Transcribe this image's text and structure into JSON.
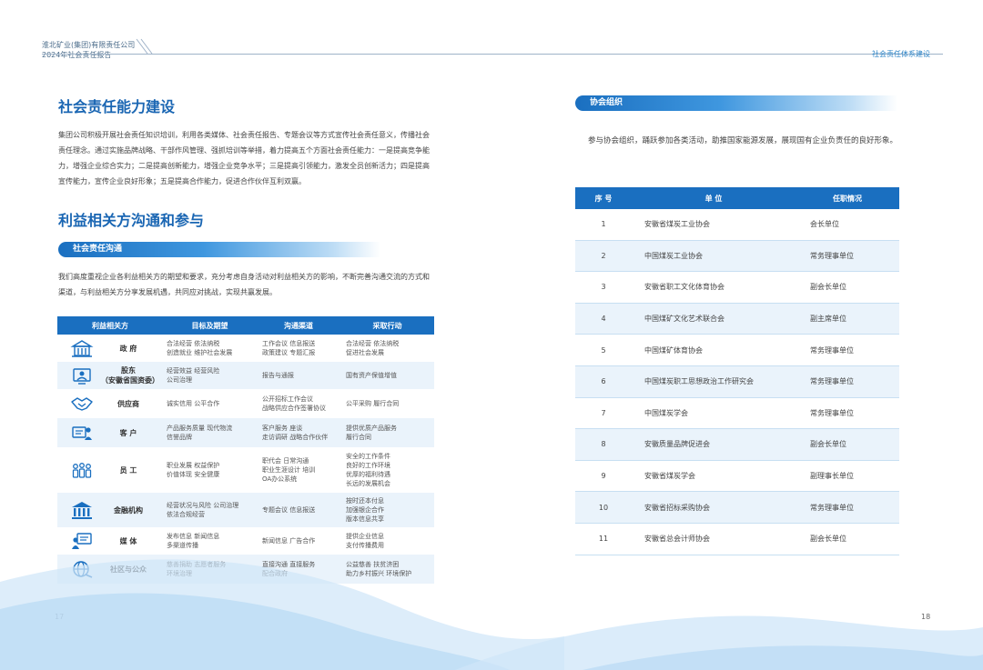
{
  "header": {
    "company": "淮北矿业(集团)有限责任公司",
    "report": "2024年社会责任报告",
    "section": "社会责任体系建设"
  },
  "left": {
    "capacity": {
      "title": "社会责任能力建设",
      "text": "集团公司积极开展社会责任知识培训，利用各类媒体、社会责任报告、专题会议等方式宣传社会责任意义，传播社会责任理念。通过实施品牌战略、干部作风管理、强抓培训等举措，着力提高五个方面社会责任能力：一是提高竞争能力，增强企业综合实力；二是提高创新能力，增强企业竞争水平；三是提高引领能力，激发全员创新活力；四是提高宣传能力，宣传企业良好形象；五是提高合作能力，促进合作伙伴互利双赢。"
    },
    "stakeholder": {
      "title": "利益相关方沟通和参与",
      "subtitle": "社会责任沟通",
      "text": "我们高度重视企业各利益相关方的期望和要求，充分考虑自身活动对利益相关方的影响，不断完善沟通交流的方式和渠道，与利益相关方分享发展机遇，共同应对挑战，实现共赢发展。",
      "columns": [
        "利益相关方",
        "目标及期望",
        "沟通渠道",
        "采取行动"
      ],
      "rows": [
        {
          "icon": "government-icon",
          "name": "政 府",
          "goals": "合法经营 依法纳税\n创造就业 维护社会发展",
          "channels": "工作会议 信息报送\n政策建议 专题汇报",
          "actions": "合法经营 依法纳税\n促进社会发展"
        },
        {
          "icon": "shareholder-icon",
          "name": "股东\n（安徽省国资委）",
          "goals": "经营效益 经营风险\n公司治理",
          "channels": "报告与通报",
          "actions": "国有资产保值增值"
        },
        {
          "icon": "handshake-icon",
          "name": "供应商",
          "goals": "诚实信用 公平合作",
          "channels": "公开招标工作会议\n战略供应合作签署协议",
          "actions": "公平采购 履行合同"
        },
        {
          "icon": "customer-icon",
          "name": "客 户",
          "goals": "产品服务质量 现代物流\n信誉品牌",
          "channels": "客户服务 座谈\n走访调研 战略合作伙伴",
          "actions": "提供优质产品服务\n履行合同"
        },
        {
          "icon": "employees-icon",
          "name": "员 工",
          "goals": "职业发展 权益保护\n价值体现 安全健康",
          "channels": "职代会 日常沟通\n职业生涯设计 培训\nOA办公系统",
          "actions": "安全的工作条件\n良好的工作环境\n优厚的福利待遇\n长远的发展机会"
        },
        {
          "icon": "bank-icon",
          "name": "金融机构",
          "goals": "经营状况与风险 公司治理\n依法合规经营",
          "channels": "专题会议 信息报送",
          "actions": "按时还本付息\n加强银企合作\n版本信息共享"
        },
        {
          "icon": "media-icon",
          "name": "媒 体",
          "goals": "发布信息 新闻信息\n多渠道传播",
          "channels": "新闻信息 广告合作",
          "actions": "提供企业信息\n支付传播费用"
        },
        {
          "icon": "globe-icon",
          "name": "社区与公众",
          "goals": "慈善捐助 志愿者服务\n环境治理",
          "channels": "直接沟通 直接服务\n配合政府",
          "actions": "公益慈善 扶贫济困\n助力乡村振兴 环境保护"
        }
      ]
    },
    "page_number": "17"
  },
  "right": {
    "association": {
      "title": "协会组织",
      "text": "参与协会组织，踊跃参加各类活动，助推国家能源发展，展现国有企业负责任的良好形象。",
      "columns": [
        "序 号",
        "单 位",
        "任职情况"
      ],
      "rows": [
        {
          "no": "1",
          "unit": "安徽省煤炭工业协会",
          "role": "会长单位"
        },
        {
          "no": "2",
          "unit": "中国煤炭工业协会",
          "role": "常务理事单位"
        },
        {
          "no": "3",
          "unit": "安徽省职工文化体育协会",
          "role": "副会长单位"
        },
        {
          "no": "4",
          "unit": "中国煤矿文化艺术联合会",
          "role": "副主席单位"
        },
        {
          "no": "5",
          "unit": "中国煤矿体育协会",
          "role": "常务理事单位"
        },
        {
          "no": "6",
          "unit": "中国煤炭职工思想政治工作研究会",
          "role": "常务理事单位"
        },
        {
          "no": "7",
          "unit": "中国煤炭学会",
          "role": "常务理事单位"
        },
        {
          "no": "8",
          "unit": "安徽质量品牌促进会",
          "role": "副会长单位"
        },
        {
          "no": "9",
          "unit": "安徽省煤炭学会",
          "role": "副理事长单位"
        },
        {
          "no": "10",
          "unit": "安徽省招标采购协会",
          "role": "常务理事单位"
        },
        {
          "no": "11",
          "unit": "安徽省总会计师协会",
          "role": "副会长单位"
        }
      ]
    },
    "page_number": "18"
  },
  "colors": {
    "primary": "#1a6fc0",
    "title": "#1a66b3",
    "row_alt": "#eaf3fb"
  }
}
